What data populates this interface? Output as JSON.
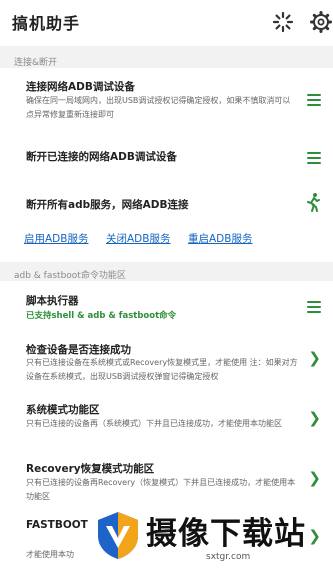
{
  "app": {
    "title": "搞机助手"
  },
  "sections": {
    "connect": "连接&断开",
    "adb": "adb & fastboot命令功能区"
  },
  "rows": {
    "connect_net": {
      "title": "连接网络ADB调试设备",
      "desc": "确保在同一局域网内，出现USB调试授权记得确定授权，如果不慎取消可以点异常修复重新连接即可"
    },
    "disconnect_net": {
      "title": "断开已连接的网络ADB调试设备"
    },
    "disconnect_all": {
      "title": "断开所有adb服务，网络ADB连接"
    },
    "script": {
      "title": "脚本执行器",
      "sub": "已支持shell & adb & fastboot命令"
    },
    "check": {
      "title": "检查设备是否连接成功",
      "desc": "只有已连接设备在系统模式或Recovery恢复模式里，才能使用 注：如果对方设备在系统模式，出现USB调试授权弹窗记得确定授权"
    },
    "system": {
      "title": "系统模式功能区",
      "desc": "只有已连接的设备再（系统模式）下并且已连接成功，才能使用本功能区"
    },
    "recovery": {
      "title": "Recovery恢复模式功能区",
      "desc": "只有已连接的设备再Recovery（恢复模式）下并且已连接成功，才能使用本功能区"
    },
    "fastboot": {
      "title": "FASTBOOT",
      "desc": "才能使用本功"
    }
  },
  "links": {
    "enable": "启用ADB服务",
    "close": "关闭ADB服务",
    "restart": "重启ADB服务"
  },
  "watermark": {
    "text": "摄像下载站",
    "url": "sxtgr.com"
  },
  "icons": {
    "refresh": "loading-spinner-icon",
    "settings": "gear-icon",
    "menu": "hamburger-icon",
    "run": "running-person-icon",
    "chevron": "chevron-right-icon"
  },
  "colors": {
    "accent": "#2e8f3a",
    "link": "#1565c0"
  }
}
